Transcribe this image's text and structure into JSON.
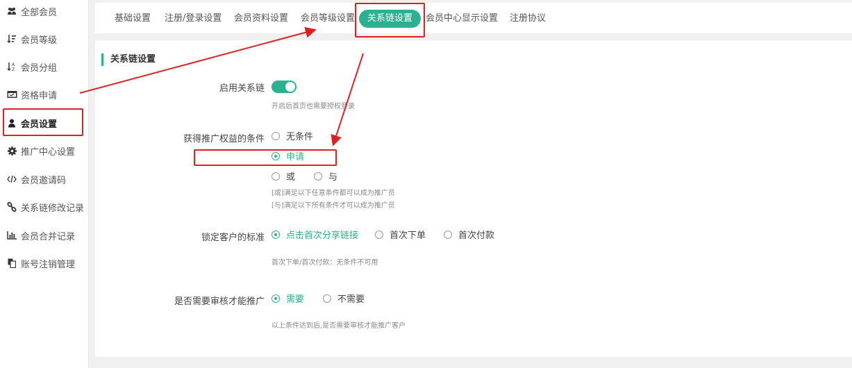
{
  "sidebar": {
    "items": [
      {
        "label": "全部会员",
        "icon": "users-icon"
      },
      {
        "label": "会员等级",
        "icon": "sort-level-icon"
      },
      {
        "label": "会员分组",
        "icon": "sort-az-icon"
      },
      {
        "label": "资格申请",
        "icon": "inbox-icon"
      },
      {
        "label": "会员设置",
        "icon": "user-icon"
      },
      {
        "label": "推广中心设置",
        "icon": "gear-icon"
      },
      {
        "label": "会员邀请码",
        "icon": "code-icon"
      },
      {
        "label": "关系链修改记录",
        "icon": "link-icon"
      },
      {
        "label": "会员合并记录",
        "icon": "bar-chart-icon"
      },
      {
        "label": "账号注销管理",
        "icon": "file-icon"
      }
    ]
  },
  "tabs": [
    "基础设置",
    "注册/登录设置",
    "会员资料设置",
    "会员等级设置",
    "关系链设置",
    "会员中心显示设置",
    "注册协议"
  ],
  "section": {
    "title": "关系链设置",
    "enable_label": "启用关系链",
    "enable_hint": "开启后首页也需要授权登录",
    "promo_label": "获得推广权益的条件",
    "promo_options": [
      "无条件",
      "申请",
      "或",
      "与"
    ],
    "promo_hint1": "[或]满足以下任意条件都可以成为推广员",
    "promo_hint2": "[与]满足以下所有条件才可以成为推广员",
    "lock_label": "锁定客户的标准",
    "lock_options": [
      "点击首次分享链接",
      "首次下单",
      "首次付款"
    ],
    "lock_hint": "首次下单/首次付款：无条件不可用",
    "review_label": "是否需要审核才能推广",
    "review_options": [
      "需要",
      "不需要"
    ],
    "review_hint": "以上条件达到后,是否需要审核才能推广客户"
  },
  "colors": {
    "accent": "#2bb18f",
    "annotation": "#e02020"
  }
}
